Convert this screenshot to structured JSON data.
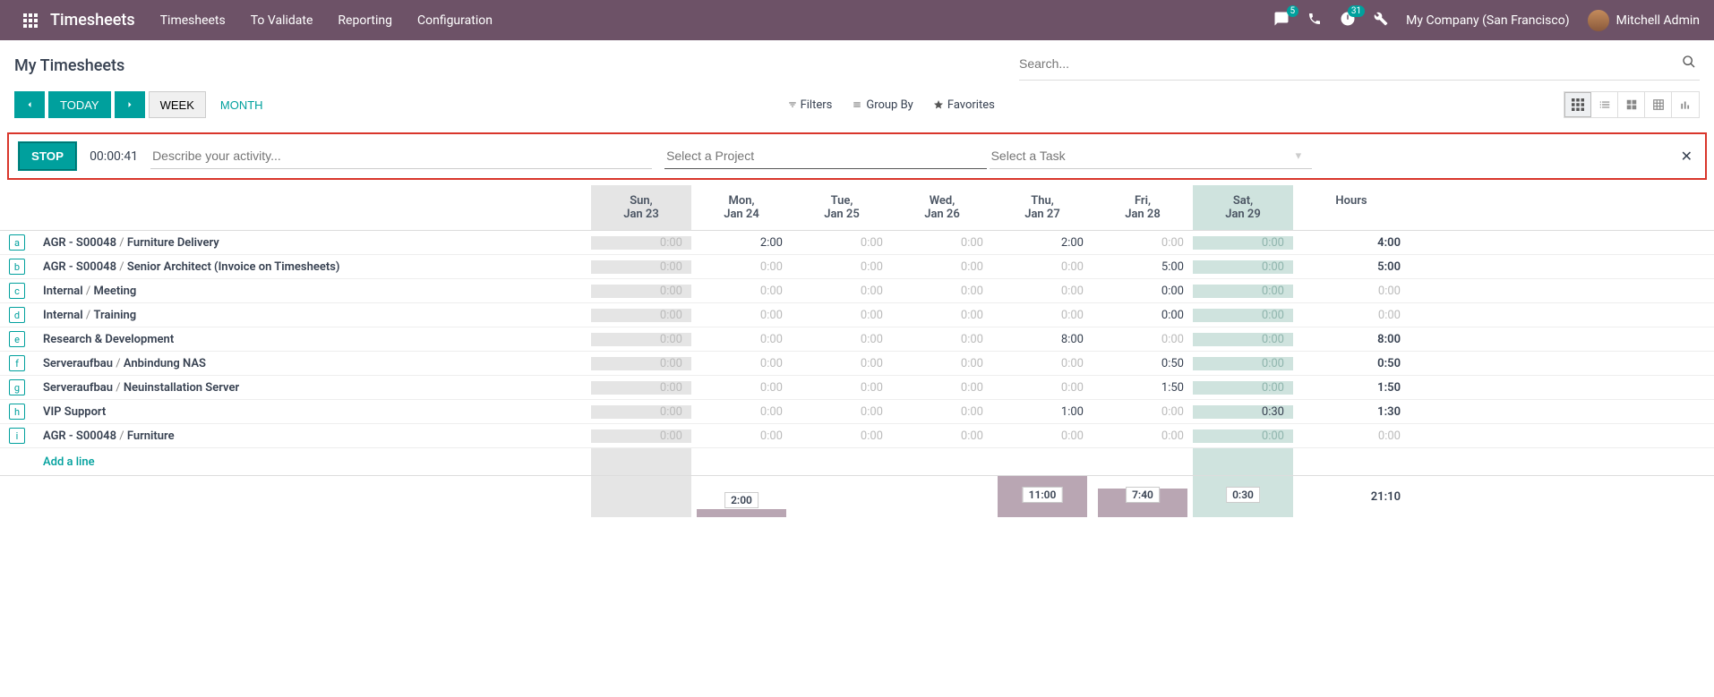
{
  "topbar": {
    "app_title": "Timesheets",
    "nav": [
      "Timesheets",
      "To Validate",
      "Reporting",
      "Configuration"
    ],
    "messages_badge": "5",
    "activities_badge": "31",
    "company": "My Company (San Francisco)",
    "user": "Mitchell Admin"
  },
  "control": {
    "page_title": "My Timesheets",
    "search_placeholder": "Search..."
  },
  "toolbar": {
    "today": "TODAY",
    "week": "WEEK",
    "month": "MONTH",
    "filters": "Filters",
    "groupby": "Group By",
    "favorites": "Favorites"
  },
  "timer": {
    "stop": "STOP",
    "value": "00:00:41",
    "desc_placeholder": "Describe your activity...",
    "project_placeholder": "Select a Project",
    "task_placeholder": "Select a Task"
  },
  "columns": [
    {
      "l1": "Sun,",
      "l2": "Jan 23"
    },
    {
      "l1": "Mon,",
      "l2": "Jan 24"
    },
    {
      "l1": "Tue,",
      "l2": "Jan 25"
    },
    {
      "l1": "Wed,",
      "l2": "Jan 26"
    },
    {
      "l1": "Thu,",
      "l2": "Jan 27"
    },
    {
      "l1": "Fri,",
      "l2": "Jan 28"
    },
    {
      "l1": "Sat,",
      "l2": "Jan 29"
    }
  ],
  "hours_label": "Hours",
  "rows": [
    {
      "key": "a",
      "proj": "AGR - S00048",
      "task": "Furniture Delivery",
      "cells": [
        "0:00",
        "2:00",
        "0:00",
        "0:00",
        "2:00",
        "0:00",
        "0:00"
      ],
      "zero": [
        true,
        false,
        true,
        true,
        false,
        true,
        true
      ],
      "total": "4:00",
      "totalZero": false
    },
    {
      "key": "b",
      "proj": "AGR - S00048",
      "task": "Senior Architect (Invoice on Timesheets)",
      "cells": [
        "0:00",
        "0:00",
        "0:00",
        "0:00",
        "0:00",
        "5:00",
        "0:00"
      ],
      "zero": [
        true,
        true,
        true,
        true,
        true,
        false,
        true
      ],
      "total": "5:00",
      "totalZero": false
    },
    {
      "key": "c",
      "proj": "Internal",
      "task": "Meeting",
      "cells": [
        "0:00",
        "0:00",
        "0:00",
        "0:00",
        "0:00",
        "0:00",
        "0:00"
      ],
      "zero": [
        true,
        true,
        true,
        true,
        true,
        false,
        true
      ],
      "total": "0:00",
      "totalZero": true
    },
    {
      "key": "d",
      "proj": "Internal",
      "task": "Training",
      "cells": [
        "0:00",
        "0:00",
        "0:00",
        "0:00",
        "0:00",
        "0:00",
        "0:00"
      ],
      "zero": [
        true,
        true,
        true,
        true,
        true,
        false,
        true
      ],
      "total": "0:00",
      "totalZero": true
    },
    {
      "key": "e",
      "proj": "Research & Development",
      "task": "",
      "cells": [
        "0:00",
        "0:00",
        "0:00",
        "0:00",
        "8:00",
        "0:00",
        "0:00"
      ],
      "zero": [
        true,
        true,
        true,
        true,
        false,
        true,
        true
      ],
      "total": "8:00",
      "totalZero": false
    },
    {
      "key": "f",
      "proj": "Serveraufbau",
      "task": "Anbindung NAS",
      "cells": [
        "0:00",
        "0:00",
        "0:00",
        "0:00",
        "0:00",
        "0:50",
        "0:00"
      ],
      "zero": [
        true,
        true,
        true,
        true,
        true,
        false,
        true
      ],
      "total": "0:50",
      "totalZero": false
    },
    {
      "key": "g",
      "proj": "Serveraufbau",
      "task": "Neuinstallation Server",
      "cells": [
        "0:00",
        "0:00",
        "0:00",
        "0:00",
        "0:00",
        "1:50",
        "0:00"
      ],
      "zero": [
        true,
        true,
        true,
        true,
        true,
        false,
        true
      ],
      "total": "1:50",
      "totalZero": false
    },
    {
      "key": "h",
      "proj": "VIP Support",
      "task": "",
      "cells": [
        "0:00",
        "0:00",
        "0:00",
        "0:00",
        "1:00",
        "0:00",
        "0:30"
      ],
      "zero": [
        true,
        true,
        true,
        true,
        false,
        true,
        false
      ],
      "total": "1:30",
      "totalZero": false
    },
    {
      "key": "i",
      "proj": "AGR - S00048",
      "task": "Furniture",
      "cells": [
        "0:00",
        "0:00",
        "0:00",
        "0:00",
        "0:00",
        "0:00",
        "0:00"
      ],
      "zero": [
        true,
        true,
        true,
        true,
        true,
        true,
        true
      ],
      "total": "0:00",
      "totalZero": true
    }
  ],
  "add_line": "Add a line",
  "footer": {
    "bars": [
      {
        "label": "",
        "h": 0
      },
      {
        "label": "2:00",
        "h": 9
      },
      {
        "label": "",
        "h": 0
      },
      {
        "label": "",
        "h": 0
      },
      {
        "label": "11:00",
        "h": 46
      },
      {
        "label": "7:40",
        "h": 32
      },
      {
        "label": "0:30",
        "h": 0
      }
    ],
    "total": "21:10"
  }
}
